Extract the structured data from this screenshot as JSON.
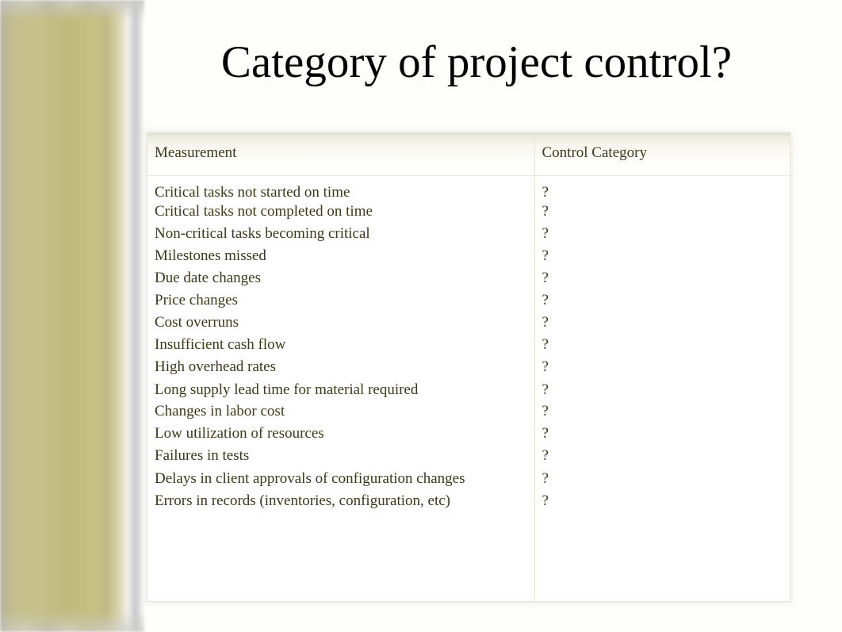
{
  "slide": {
    "title": "Category of project control?",
    "background_color": "#fefefd",
    "text_color": "#3b3a18",
    "accent_gold": "#c9c289"
  },
  "table": {
    "headers": {
      "measurement": "Measurement",
      "control_category": "Control Category"
    },
    "rows": [
      {
        "measurement": "Critical tasks not started on time",
        "control_category": "?"
      },
      {
        "measurement": "Critical tasks not completed on time",
        "control_category": "?"
      },
      {
        "measurement": "Non-critical tasks becoming critical",
        "control_category": "?"
      },
      {
        "measurement": "Milestones missed",
        "control_category": "?"
      },
      {
        "measurement": "Due date changes",
        "control_category": "?"
      },
      {
        "measurement": "Price changes",
        "control_category": "?"
      },
      {
        "measurement": "Cost overruns",
        "control_category": "?"
      },
      {
        "measurement": "Insufficient cash flow",
        "control_category": "?"
      },
      {
        "measurement": "High overhead rates",
        "control_category": "?"
      },
      {
        "measurement": "Long supply lead time for material required",
        "control_category": "?"
      },
      {
        "measurement": "Changes in labor cost",
        "control_category": "?"
      },
      {
        "measurement": "Low utilization of resources",
        "control_category": "?"
      },
      {
        "measurement": "Failures in tests",
        "control_category": "?"
      },
      {
        "measurement": "Delays in client approvals of configuration changes",
        "control_category": "?"
      },
      {
        "measurement": "Errors in records (inventories, configuration, etc)",
        "control_category": "?"
      }
    ]
  }
}
